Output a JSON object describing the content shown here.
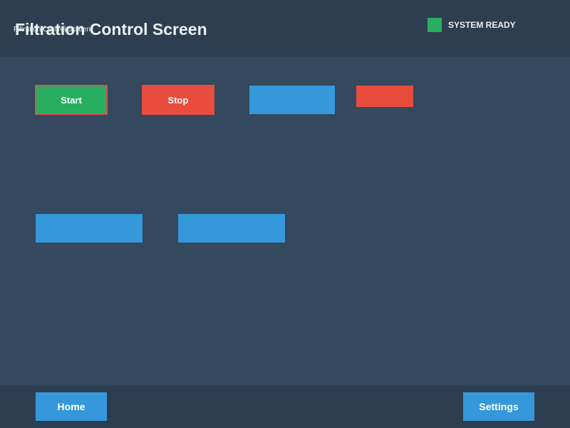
{
  "header": {
    "title": "Filtration Control Screen",
    "title_overlay": "Filtration Control Screen",
    "status": {
      "label": "SYSTEM READY",
      "indicator_color": "#27ae60"
    }
  },
  "controls": {
    "start_label": "Start",
    "stop_label": "Stop"
  },
  "footer": {
    "home_label": "Home",
    "settings_label": "Settings"
  },
  "colors": {
    "background": "#34495e",
    "header_bg": "#2c3e50",
    "start": "#27ae60",
    "stop": "#e74c3c",
    "accent_blue": "#3498db",
    "text": "#ecf0f1"
  }
}
